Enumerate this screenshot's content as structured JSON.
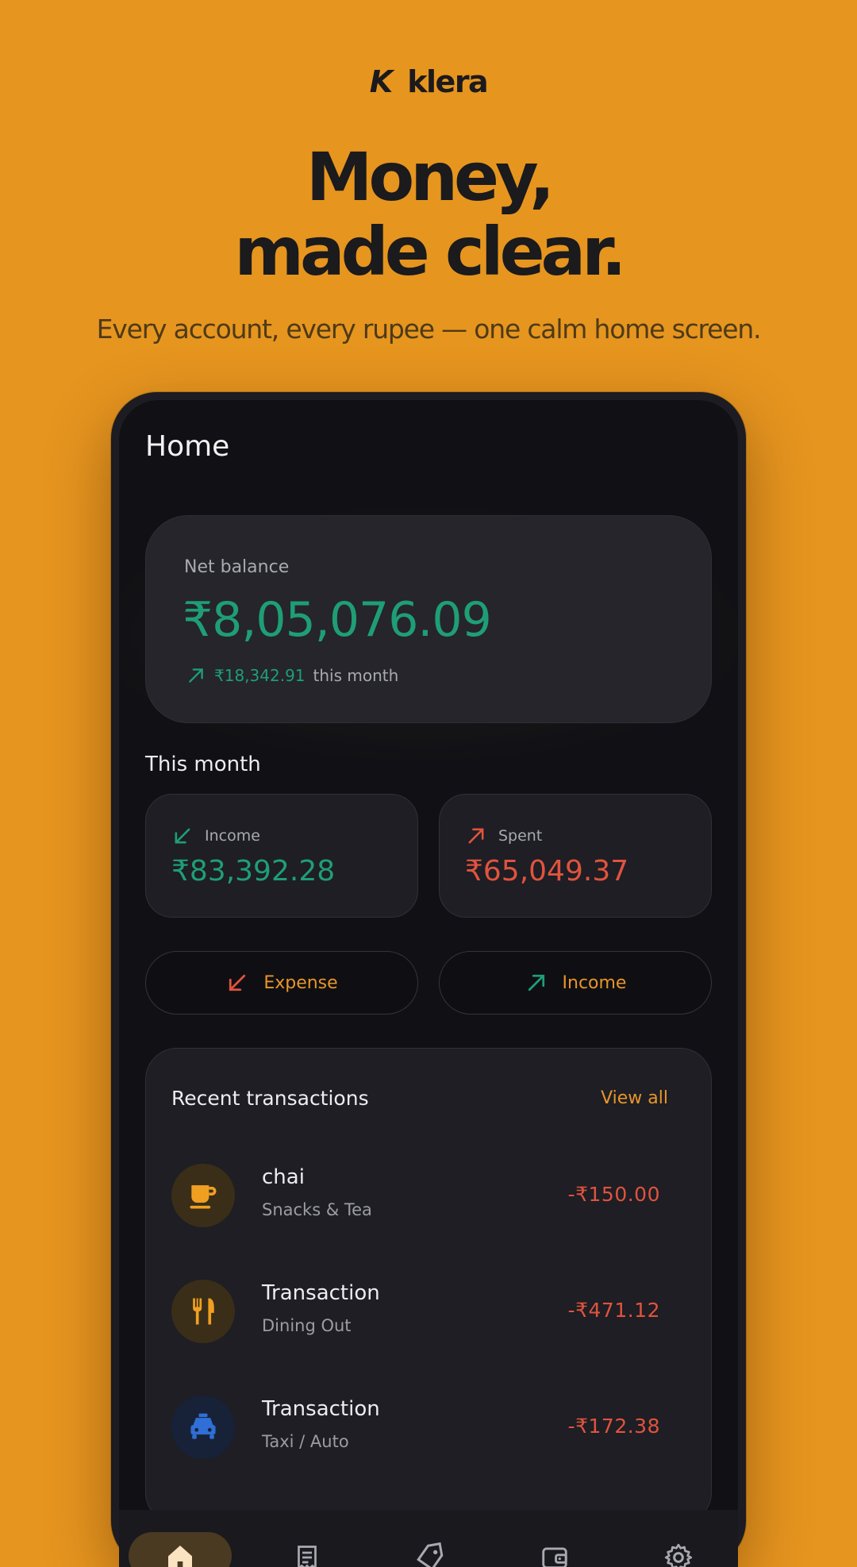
{
  "brand": {
    "mark": "K",
    "name": "klera"
  },
  "hero": {
    "headline_line1": "Money,",
    "headline_line2": "made clear.",
    "subhead": "Every account, every rupee — one calm home screen."
  },
  "screen": {
    "title": "Home",
    "balance": {
      "label": "Net balance",
      "amount": "₹8,05,076.09",
      "delta_value": "₹18,342.91",
      "delta_suffix": "this month"
    },
    "this_month": {
      "label": "This month",
      "income": {
        "label": "Income",
        "value": "₹83,392.28"
      },
      "spent": {
        "label": "Spent",
        "value": "₹65,049.37"
      }
    },
    "actions": {
      "expense_label": "Expense",
      "income_label": "Income"
    },
    "recent": {
      "title": "Recent transactions",
      "view_all": "View all",
      "items": [
        {
          "name": "chai",
          "category": "Snacks & Tea",
          "amount": "-₹150.00",
          "icon": "coffee-cup-icon"
        },
        {
          "name": "Transaction",
          "category": "Dining Out",
          "amount": "-₹471.12",
          "icon": "fork-knife-icon"
        },
        {
          "name": "Transaction",
          "category": "Taxi / Auto",
          "amount": "-₹172.38",
          "icon": "taxi-icon"
        }
      ]
    },
    "nav": [
      "home-icon",
      "receipt-icon",
      "tag-icon",
      "wallet-icon",
      "settings-gear-icon"
    ]
  },
  "colors": {
    "background": "#E6951F",
    "income_green": "#1F9E75",
    "expense_red": "#E0533E",
    "accent_orange": "#E8952A"
  }
}
